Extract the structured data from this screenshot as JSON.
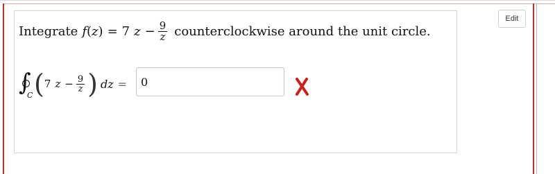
{
  "question": {
    "prompt_prefix": "Integrate",
    "function_name": "f",
    "variable": "z",
    "equals": "=",
    "coefficient": "7",
    "minus": "−",
    "frac_num": "9",
    "frac_den": "z",
    "prompt_suffix": "counterclockwise around the unit circle."
  },
  "integral": {
    "contour_label": "C",
    "coefficient": "7",
    "variable": "z",
    "minus": "−",
    "frac_num": "9",
    "frac_den": "z",
    "differential": "dz",
    "equals": "="
  },
  "answer": {
    "value": "0",
    "status": "incorrect",
    "status_color": "#cc1f1a"
  },
  "toolbar": {
    "edit_label": "Edit"
  },
  "colors": {
    "frame_accent": "#c9302c",
    "box_border": "#d4d4d4"
  }
}
